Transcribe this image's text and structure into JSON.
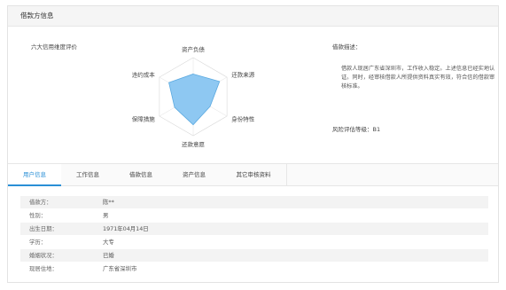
{
  "header": {
    "title": "借款方信息"
  },
  "evaluation": {
    "title": "六大信用维度评价",
    "axes": [
      "资产负债",
      "还款来源",
      "身份特性",
      "还款意愿",
      "保障措施",
      "违约成本"
    ],
    "values": [
      0.58,
      0.78,
      0.5,
      0.72,
      0.55,
      0.72
    ],
    "fill_color": "#8ec8f2",
    "stroke_color": "#5aa9e0"
  },
  "description": {
    "title": "借款描述：",
    "text": "借款人现居广东省深圳市，工作收入稳定。上述信息已经实地认证。同时，经审核借款人所提供资料真实有效，符合信的借款审核标准。"
  },
  "risk": {
    "label": "风险评估等级：",
    "value": "B1"
  },
  "tabs": [
    {
      "label": "用户信息",
      "active": true
    },
    {
      "label": "工作信息",
      "active": false
    },
    {
      "label": "借款信息",
      "active": false
    },
    {
      "label": "资产信息",
      "active": false
    },
    {
      "label": "其它审核资料",
      "active": false
    }
  ],
  "user_info": [
    {
      "key": "借款方：",
      "value": "陈**"
    },
    {
      "key": "性别：",
      "value": "男"
    },
    {
      "key": "出生日期：",
      "value": "1971年04月14日"
    },
    {
      "key": "学历：",
      "value": "大专"
    },
    {
      "key": "婚姻状况：",
      "value": "已婚"
    },
    {
      "key": "现居住地：",
      "value": "广东省深圳市"
    }
  ],
  "colors": {
    "accent": "#2a8fd6",
    "header_bg": "#f5f5f5"
  }
}
